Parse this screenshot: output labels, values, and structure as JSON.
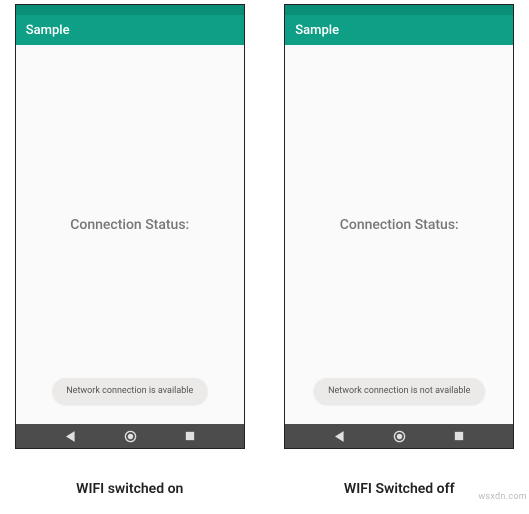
{
  "phones": [
    {
      "app_title": "Sample",
      "status_label": "Connection Status:",
      "toast_text": "Network connection is available",
      "caption": "WIFI switched on"
    },
    {
      "app_title": "Sample",
      "status_label": "Connection Status:",
      "toast_text": "Network connection is not available",
      "caption": "WIFI Switched off"
    }
  ],
  "colors": {
    "appbar": "#0f9e86",
    "statusbar": "#0b8e77",
    "navbar": "#4c4c4c"
  },
  "watermark": "wsxdn.com"
}
